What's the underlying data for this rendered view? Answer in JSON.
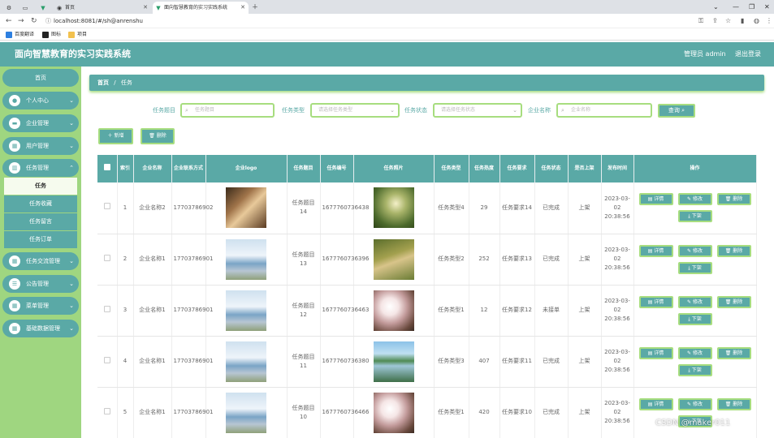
{
  "browser": {
    "tabs": [
      {
        "label": ""
      },
      {
        "label": ""
      },
      {
        "label": ""
      },
      {
        "label": "首页"
      },
      {
        "label": "面向智慧教育的实习实践系统"
      }
    ],
    "url": "localhost:8081/#/sh@anrenshu",
    "bookmarks": [
      "百度翻译",
      "图标",
      "项目"
    ]
  },
  "header": {
    "title": "面向智慧教育的实习实践系统",
    "admin": "管理员 admin",
    "logout": "退出登录"
  },
  "sidebar": {
    "home": "首页",
    "menus": [
      {
        "label": "个人中心",
        "icon": "user-icon"
      },
      {
        "label": "企业管理",
        "icon": "building-icon"
      },
      {
        "label": "用户管理",
        "icon": "grid-icon"
      },
      {
        "label": "任务管理",
        "icon": "chart-icon"
      }
    ],
    "submenu": [
      "任务",
      "任务收藏",
      "任务留言",
      "任务订单"
    ],
    "menus2": [
      {
        "label": "任务交流管理",
        "icon": "grid-icon"
      },
      {
        "label": "公告管理",
        "icon": "list-icon"
      },
      {
        "label": "菜单管理",
        "icon": "grid-icon"
      },
      {
        "label": "基础数据管理",
        "icon": "grid-icon"
      }
    ]
  },
  "breadcrumb": {
    "home": "首页",
    "sep": "/",
    "current": "任务"
  },
  "filters": {
    "title_label": "任务题目",
    "title_placeholder": "任务题目",
    "type_label": "任务类型",
    "type_placeholder": "请选择任务类型",
    "status_label": "任务状态",
    "status_placeholder": "请选择任务状态",
    "company_label": "企业名称",
    "company_placeholder": "企业名称",
    "query": "查询"
  },
  "actions": {
    "add": "新增",
    "delete": "删除"
  },
  "table": {
    "headers": [
      "索引",
      "企业名称",
      "企业联系方式",
      "企业logo",
      "任务题目",
      "任务编号",
      "任务照片",
      "任务类型",
      "任务热度",
      "任务要求",
      "任务状态",
      "是否上架",
      "发布时间",
      "操作"
    ],
    "row_actions": {
      "detail": "详情",
      "edit": "修改",
      "delete": "删除",
      "offshelf": "下架"
    },
    "rows": [
      {
        "index": "1",
        "company": "企业名称2",
        "phone": "17703786902",
        "logo": "logo-a",
        "title": "任务题目14",
        "code": "1677760736438",
        "photo": "ph-path",
        "type": "任务类型4",
        "heat": "29",
        "req": "任务要求14",
        "status": "已完成",
        "shelf": "上架",
        "time": "2023-03-02 20:38:56"
      },
      {
        "index": "2",
        "company": "企业名称1",
        "phone": "17703786901",
        "logo": "logo-b",
        "title": "任务题目13",
        "code": "1677760736396",
        "photo": "ph-road",
        "type": "任务类型2",
        "heat": "252",
        "req": "任务要求13",
        "status": "已完成",
        "shelf": "上架",
        "time": "2023-03-02 20:38:56"
      },
      {
        "index": "3",
        "company": "企业名称1",
        "phone": "17703786901",
        "logo": "logo-b",
        "title": "任务题目12",
        "code": "1677760736463",
        "photo": "ph-flower",
        "type": "任务类型1",
        "heat": "12",
        "req": "任务要求12",
        "status": "未接单",
        "shelf": "上架",
        "time": "2023-03-02 20:38:56"
      },
      {
        "index": "4",
        "company": "企业名称1",
        "phone": "17703786901",
        "logo": "logo-b",
        "title": "任务题目11",
        "code": "1677760736380",
        "photo": "ph-lake",
        "type": "任务类型3",
        "heat": "407",
        "req": "任务要求11",
        "status": "已完成",
        "shelf": "上架",
        "time": "2023-03-02 20:38:56"
      },
      {
        "index": "5",
        "company": "企业名称1",
        "phone": "17703786901",
        "logo": "logo-b",
        "title": "任务题目10",
        "code": "1677760736466",
        "photo": "ph-flower",
        "type": "任务类型1",
        "heat": "420",
        "req": "任务要求10",
        "status": "已完成",
        "shelf": "上架",
        "time": "2023-03-02 20:38:56"
      }
    ]
  },
  "watermark": "CSDN @maker011"
}
